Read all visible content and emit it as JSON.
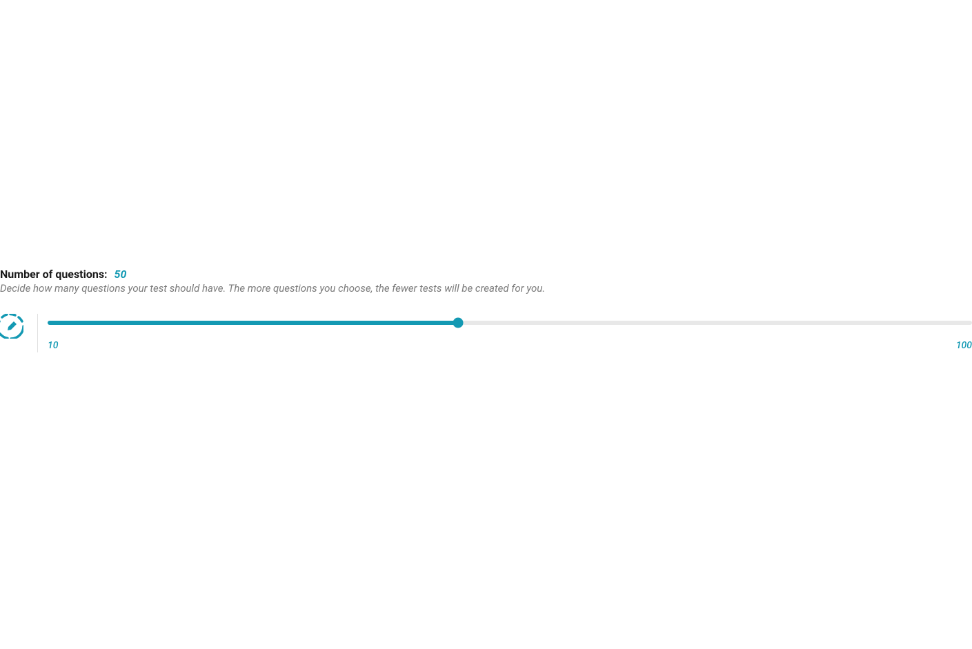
{
  "questions": {
    "label": "Number of questions:",
    "value": "50",
    "description": "Decide how many questions your test should have. The more questions you choose, the fewer tests will be created for you.",
    "slider": {
      "min": "10",
      "max": "100",
      "current": 50,
      "fillPercent": 44.44
    }
  },
  "colors": {
    "accent": "#1399b3"
  }
}
